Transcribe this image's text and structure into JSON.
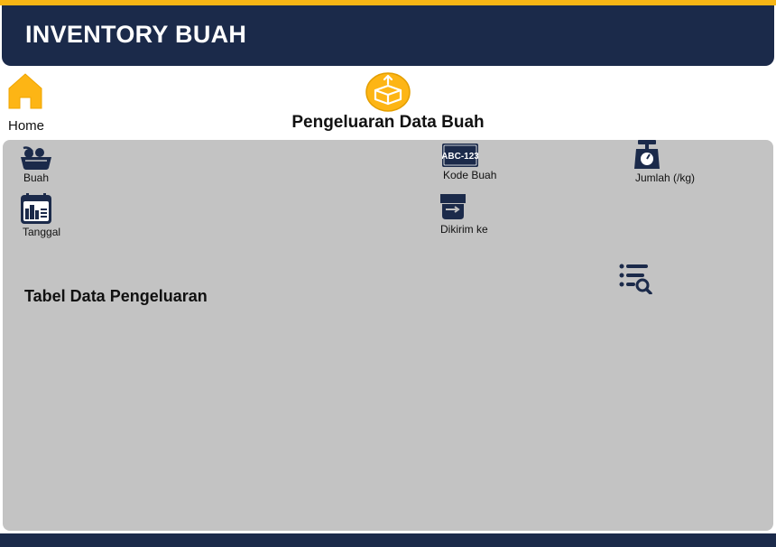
{
  "app": {
    "title": "INVENTORY BUAH",
    "accent_color": "#f7b515",
    "header_color": "#1b2a4a",
    "panel_color": "#c3c3c3"
  },
  "nav": {
    "home_label": "Home",
    "home_icon": "home-icon"
  },
  "page": {
    "title": "Pengeluaran Data Buah",
    "logo_icon": "open-box-icon"
  },
  "fields": {
    "buah": {
      "label": "Buah",
      "icon": "fruit-basket-icon"
    },
    "kode_buah": {
      "label": "Kode Buah",
      "icon": "code-plate-icon",
      "icon_text": "ABC-123"
    },
    "jumlah": {
      "label": "Jumlah (/kg)",
      "icon": "scale-icon"
    },
    "tanggal": {
      "label": "Tanggal",
      "icon": "calendar-icon"
    },
    "dikirim_ke": {
      "label": "Dikirim ke",
      "icon": "delivery-icon"
    }
  },
  "table": {
    "title": "Tabel Data Pengeluaran",
    "filter_icon": "list-search-icon"
  }
}
